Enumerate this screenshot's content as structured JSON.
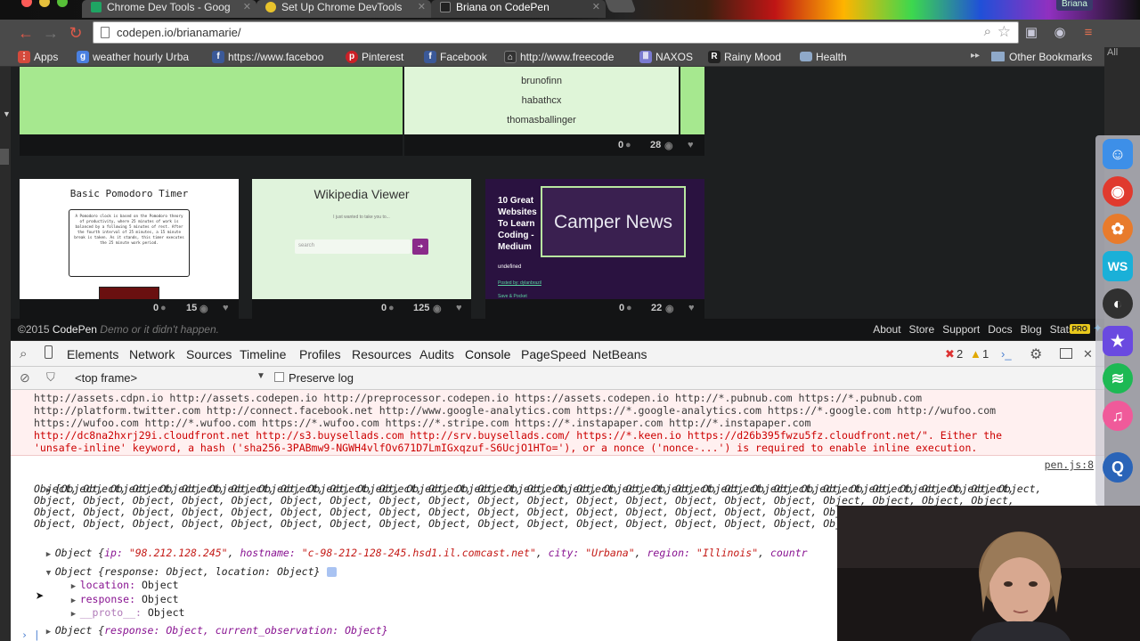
{
  "browser": {
    "tabs": [
      {
        "title": "Chrome Dev Tools - Goog",
        "icon": "google-sheets-icon",
        "icon_color": "#1fa463"
      },
      {
        "title": "Set Up Chrome DevTools",
        "icon": "chrome-icon",
        "icon_color": "#e8c32c"
      },
      {
        "title": "Briana on CodePen",
        "icon": "codepen-icon",
        "icon_color": "#222222"
      }
    ],
    "profile": "Briana",
    "url": "codepen.io/brianamarie/"
  },
  "bookmarks": {
    "items": [
      {
        "label": "Apps",
        "icon": "apps-grid-icon",
        "color": "#d44a3c"
      },
      {
        "label": "weather hourly Urba",
        "icon": "google-icon",
        "color": "#4a80e0"
      },
      {
        "label": "https://www.faceboo",
        "icon": "facebook-icon",
        "color": "#3b5998"
      },
      {
        "label": "Pinterest",
        "icon": "pinterest-icon",
        "color": "#cb2027"
      },
      {
        "label": "Facebook",
        "icon": "facebook-icon",
        "color": "#3b5998"
      },
      {
        "label": "http://www.freecode",
        "icon": "freecodecamp-icon",
        "color": "#333333"
      },
      {
        "label": "NAXOS",
        "icon": "naxos-icon",
        "color": "#7a7ad0"
      },
      {
        "label": "Rainy Mood",
        "icon": "rainy-mood-icon",
        "color": "#222222"
      },
      {
        "label": "Health",
        "icon": "folder-icon",
        "color": "#8fa9c9"
      }
    ],
    "other": "Other Bookmarks",
    "all": "All"
  },
  "pens": {
    "top_list": [
      "brunofinn",
      "habathcx",
      "thomasballinger"
    ],
    "top_stats": {
      "comments": "0",
      "views": "28"
    },
    "cards": [
      {
        "title": "Basic Pomodoro Timer",
        "body": "A Pomodoro clock is based on the Pomodoro theory of productivity, where 25 minutes of work is balanced by a following 5 minutes of rest. After the fourth interval of 25 minutes, a 15 minute break is taken. As it stands, this timer executes the 25 minute work period.",
        "comments": "0",
        "views": "15"
      },
      {
        "title": "Wikipedia Viewer",
        "subtitle": "I just wanted to take you to...",
        "search_placeholder": "search",
        "comments": "0",
        "views": "125"
      },
      {
        "title_left": "10 Great Websites To Learn Coding - Medium",
        "title_right": "Camper News",
        "sub1": "undefined",
        "sub2": "Posted by: dylanbrazil",
        "sub3": "Save & Pocket",
        "comments": "0",
        "views": "22"
      }
    ]
  },
  "codepen_footer": {
    "copyright": "©2015",
    "brand": "CodePen",
    "tagline": "Demo or it didn't happen.",
    "links": [
      "About",
      "Store",
      "Support",
      "Docs",
      "Blog",
      "Stats"
    ],
    "pro": "PRO"
  },
  "devtools": {
    "tabs": [
      "Elements",
      "Network",
      "Sources",
      "Timeline",
      "Profiles",
      "Resources",
      "Audits",
      "Console",
      "PageSpeed",
      "NetBeans"
    ],
    "errors": "2",
    "warnings": "1",
    "frame": "<top frame>",
    "preserve_log": "Preserve log",
    "console": {
      "error_lines": [
        "http://assets.cdpn.io http://assets.codepen.io http://preprocessor.codepen.io https://assets.codepen.io http://*.pubnub.com https://*.pubnub.com",
        "http://platform.twitter.com http://connect.facebook.net http://www.google-analytics.com https://*.google-analytics.com https://*.google.com http://wufoo.com",
        "https://wufoo.com http://*.wufoo.com https://*.wufoo.com https://*.stripe.com https://*.instapaper.com http://*.instapaper.com",
        "http://dc8na2hxrj29i.cloudfront.net http://s3.buysellads.com http://srv.buysellads.com/ https://*.keen.io https://d26b395fwzu5fz.cloudfront.net/\". Either the",
        "'unsafe-inline' keyword, a hash ('sha256-3PABmw9-NGWH4vlfOv671D7LmIGxqzuf-S6UcjO1HTo='), or a nonce ('nonce-...') is required to enable inline execution."
      ],
      "source_ref": "pen.js:8",
      "array_lines": [
        "[Object, Object, Object, Object, Object, Object, Object, Object, Object, Object, Object, Object, Object, Object, Object, Object, Object, Object, Object, Object,",
        "Object, Object, Object, Object, Object, Object, Object, Object, Object, Object, Object, Object, Object, Object, Object, Object, Object, Object, Object, Object,",
        "Object, Object, Object, Object, Object, Object, Object, Object, Object, Object, Object, Object, Object, Object, Object, Object, Object, Object, Object, Object,",
        "Object, Object, Object, Object, Object, Object, Object, Object, Object, Object, Object, Object, Object, Object, Object, Object, Object, Object, Object, Object,",
        "Object, Object, Object, Object, Object, Object, Object, Object, Object, Object, Object, Object, Object, Object, Object, Object, Object, Object, Object, Obje"
      ],
      "ip_label": "Object {",
      "ip_key": "ip:",
      "ip_val": "\"98.212.128.245\"",
      "hostname_key": "hostname:",
      "hostname_val": "\"c-98-212-128-245.hsd1.il.comcast.net\"",
      "city_key": "city:",
      "city_val": "\"Urbana\"",
      "region_key": "region:",
      "region_val": "\"Illinois\"",
      "country_key": "countr",
      "expanded_prefix": "Object {",
      "expanded_keys": "response: Object, location: Object}",
      "children": [
        {
          "key": "location:",
          "val": "Object"
        },
        {
          "key": "response:",
          "val": "Object"
        },
        {
          "key": "__proto__:",
          "val": "Object"
        }
      ],
      "last_prefix": "Object {",
      "last_keys": "response: Object, current_observation: Object}"
    }
  },
  "dock": [
    {
      "name": "finder-icon",
      "color": "#3d8fe8",
      "glyph": "☺"
    },
    {
      "name": "chrome-icon",
      "color": "#e03a2e",
      "glyph": "◉"
    },
    {
      "name": "photos-icon",
      "color": "#e87b2c",
      "glyph": "✿"
    },
    {
      "name": "webstorm-icon",
      "color": "#1ab0d8",
      "glyph": "WS"
    },
    {
      "name": "obs-icon",
      "color": "#303030",
      "glyph": "◐"
    },
    {
      "name": "imovie-icon",
      "color": "#6a4ae0",
      "glyph": "★"
    },
    {
      "name": "spotify-icon",
      "color": "#1db954",
      "glyph": "≋"
    },
    {
      "name": "itunes-icon",
      "color": "#f05a9a",
      "glyph": "♫"
    },
    {
      "name": "quicktime-icon",
      "color": "#2a64b8",
      "glyph": "Q"
    }
  ]
}
